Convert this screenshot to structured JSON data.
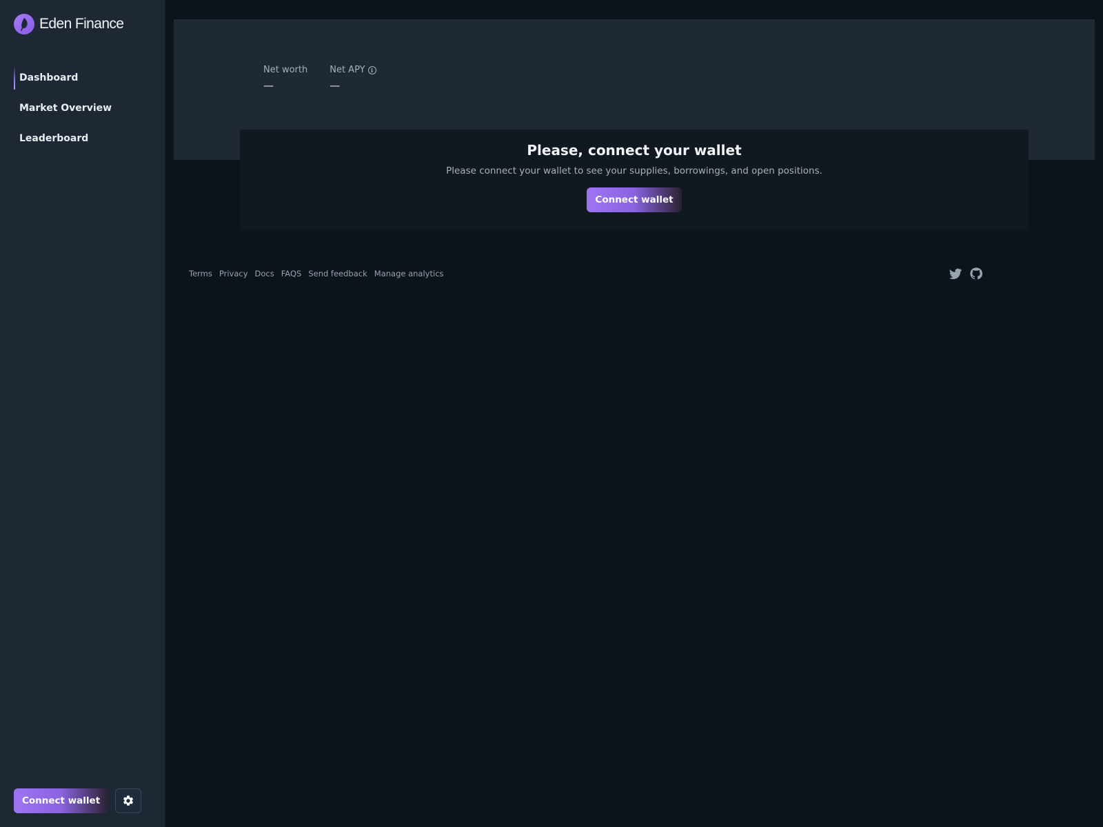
{
  "app": {
    "name": "Eden Finance"
  },
  "sidebar": {
    "nav": [
      {
        "label": "Dashboard",
        "active": true
      },
      {
        "label": "Market Overview",
        "active": false
      },
      {
        "label": "Leaderboard",
        "active": false
      }
    ],
    "connect_label": "Connect wallet",
    "settings_icon": "gear-icon"
  },
  "stats": {
    "net_worth": {
      "label": "Net worth",
      "value": "—"
    },
    "net_apy": {
      "label": "Net APY",
      "value": "—",
      "info_icon": "info-icon"
    }
  },
  "connect_card": {
    "title": "Please, connect your wallet",
    "description": "Please connect your wallet to see your supplies, borrowings, and open positions.",
    "button_label": "Connect wallet"
  },
  "footer": {
    "links": [
      "Terms",
      "Privacy",
      "Docs",
      "FAQS",
      "Send feedback",
      "Manage analytics"
    ],
    "social": [
      "twitter-icon",
      "github-icon"
    ]
  },
  "colors": {
    "accent": "#9d74f2",
    "sidebar_bg": "#1e2834",
    "page_bg": "#0c131b",
    "hero_bg": "#1e2934",
    "card_bg": "#111820"
  }
}
